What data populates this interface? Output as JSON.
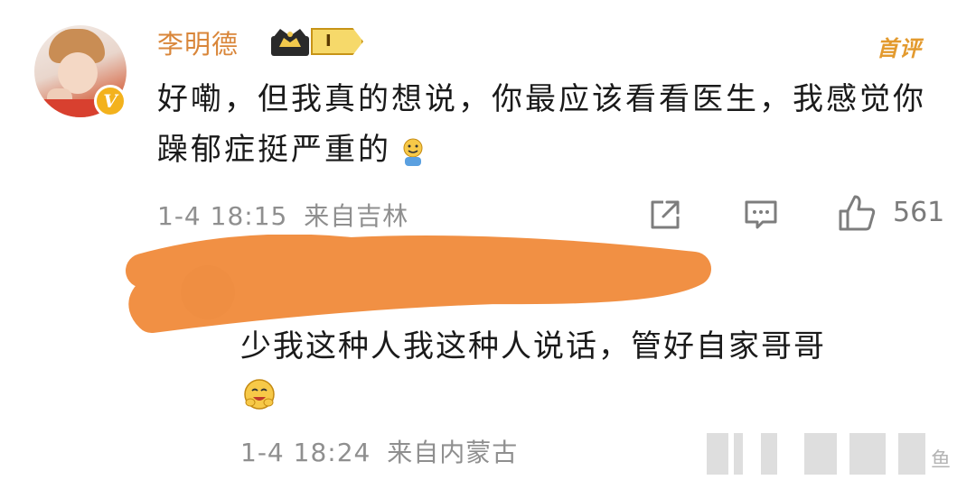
{
  "comment": {
    "username": "李明德",
    "rank_badge": "I",
    "first_comment_label": "首评",
    "text": "好嘞，但我真的想说，你最应该看看医生，我感觉你躁郁症挺严重的",
    "inline_emoji": "emoji-icon",
    "timestamp": "1-4 18:15",
    "location": "来自吉林",
    "like_count": "561"
  },
  "reply": {
    "text": "少我这种人我这种人说话，管好自家哥哥",
    "timestamp": "1-4 18:24",
    "location": "来自内蒙古",
    "username_obscured": true
  },
  "watermark": {
    "text": "鱼"
  },
  "colors": {
    "username": "#d9863a",
    "first_comment": "#e39a2e",
    "meta": "#8f8f8f",
    "scribble": "#f08a3a"
  }
}
